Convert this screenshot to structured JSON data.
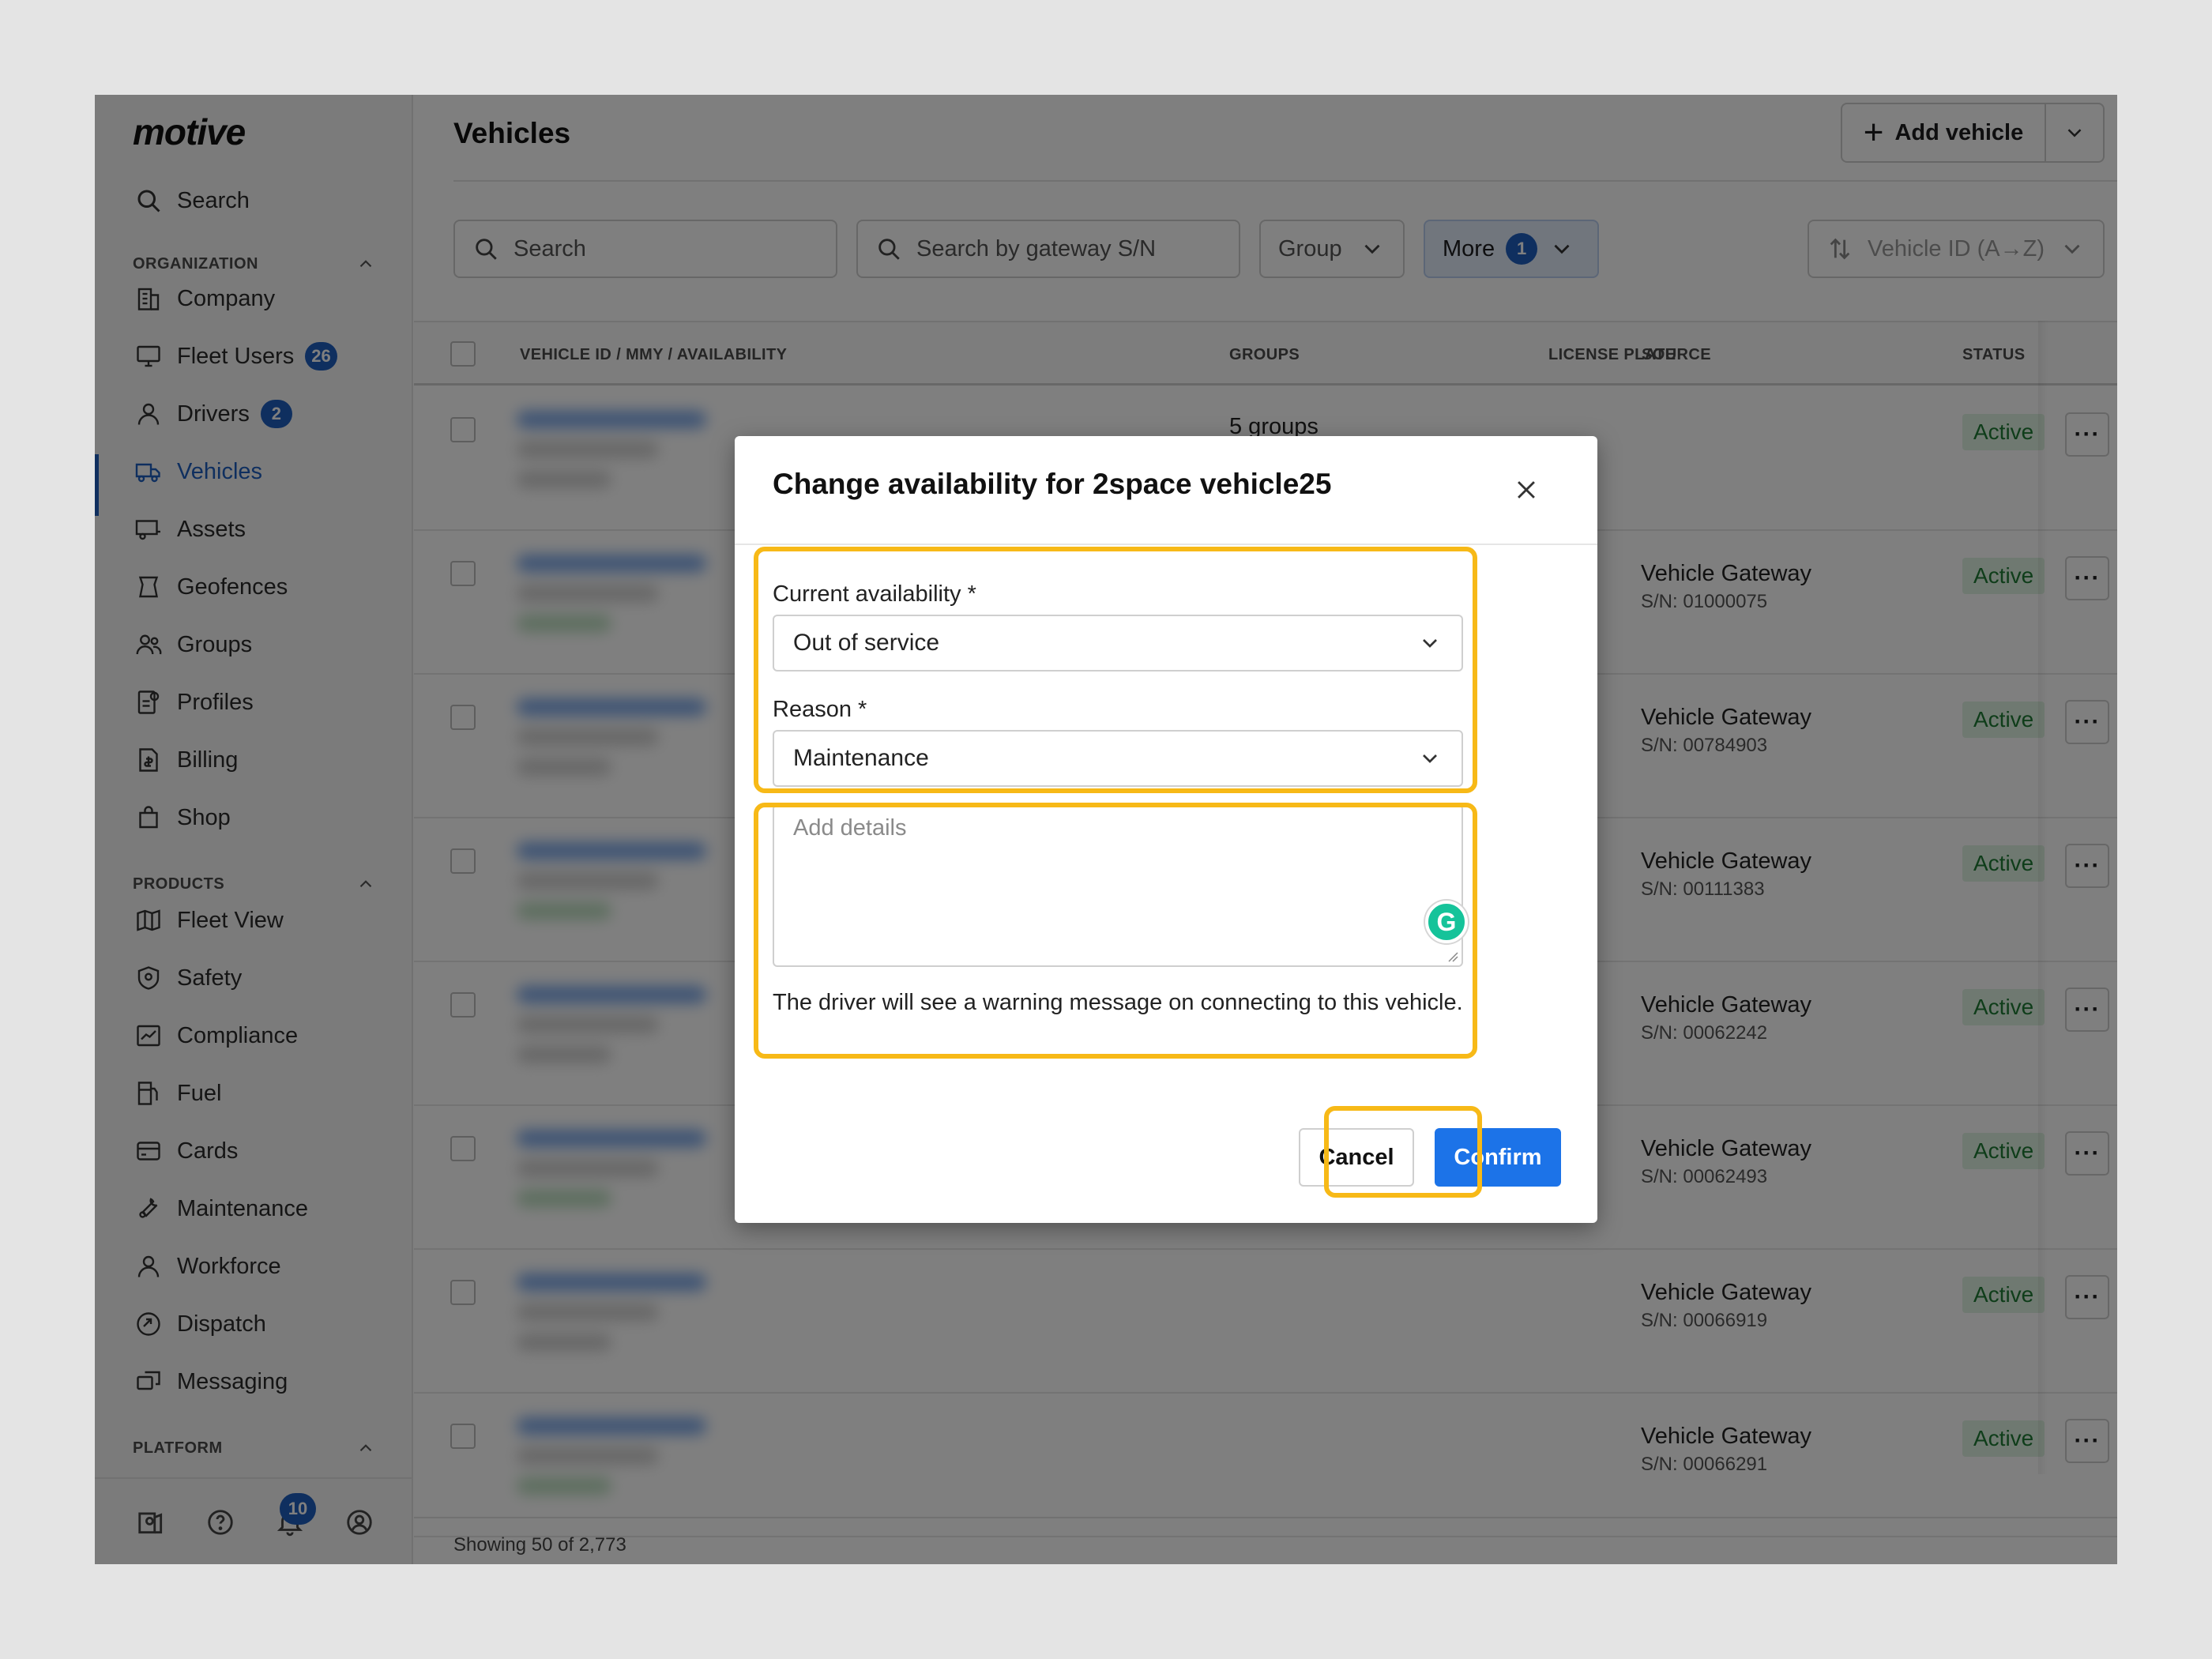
{
  "brand": "motive",
  "sidebar": {
    "search_label": "Search",
    "sections": {
      "organization": "ORGANIZATION",
      "products": "PRODUCTS",
      "platform": "PLATFORM"
    },
    "org_items": [
      {
        "label": "Company",
        "icon": "building-icon"
      },
      {
        "label": "Fleet Users",
        "icon": "monitor-icon",
        "badge": "26"
      },
      {
        "label": "Drivers",
        "icon": "person-icon",
        "badge": "2"
      },
      {
        "label": "Vehicles",
        "icon": "truck-icon",
        "active": true
      },
      {
        "label": "Assets",
        "icon": "trailer-icon"
      },
      {
        "label": "Geofences",
        "icon": "geofence-icon"
      },
      {
        "label": "Groups",
        "icon": "people-icon"
      },
      {
        "label": "Profiles",
        "icon": "profile-gear-icon"
      },
      {
        "label": "Billing",
        "icon": "billing-icon"
      },
      {
        "label": "Shop",
        "icon": "shopping-bag-icon"
      }
    ],
    "product_items": [
      {
        "label": "Fleet View",
        "icon": "map-icon"
      },
      {
        "label": "Safety",
        "icon": "shield-icon"
      },
      {
        "label": "Compliance",
        "icon": "compliance-icon"
      },
      {
        "label": "Fuel",
        "icon": "fuel-icon"
      },
      {
        "label": "Cards",
        "icon": "card-icon"
      },
      {
        "label": "Maintenance",
        "icon": "wrench-icon"
      },
      {
        "label": "Workforce",
        "icon": "person-icon"
      },
      {
        "label": "Dispatch",
        "icon": "dispatch-icon"
      },
      {
        "label": "Messaging",
        "icon": "messaging-icon"
      }
    ],
    "notification_count": "10"
  },
  "header": {
    "title": "Vehicles",
    "add_button": "Add vehicle"
  },
  "filters": {
    "search_placeholder": "Search",
    "gateway_placeholder": "Search by gateway S/N",
    "group_label": "Group",
    "more_label": "More",
    "more_count": "1",
    "sort_label": "Vehicle ID (A→Z)"
  },
  "table": {
    "columns": [
      "VEHICLE ID / MMY / AVAILABILITY",
      "GROUPS",
      "LICENSE PLATE",
      "SOURCE",
      "STATUS"
    ],
    "rows": [
      {
        "groups": "5 groups",
        "source": "",
        "sn": "",
        "status": "Active"
      },
      {
        "groups": "",
        "source": "Vehicle Gateway",
        "sn": "S/N: 01000075",
        "status": "Active"
      },
      {
        "groups": "",
        "source": "Vehicle Gateway",
        "sn": "S/N: 00784903",
        "status": "Active"
      },
      {
        "groups": "",
        "source": "Vehicle Gateway",
        "sn": "S/N: 00111383",
        "status": "Active"
      },
      {
        "groups": "",
        "source": "Vehicle Gateway",
        "sn": "S/N: 00062242",
        "status": "Active"
      },
      {
        "groups": "",
        "source": "Vehicle Gateway",
        "sn": "S/N: 00062493",
        "status": "Active"
      },
      {
        "groups": "",
        "source": "Vehicle Gateway",
        "sn": "S/N: 00066919",
        "status": "Active"
      },
      {
        "groups": "",
        "source": "Vehicle Gateway",
        "sn": "S/N: 00066291",
        "status": "Active"
      }
    ],
    "footer": "Showing 50 of 2,773"
  },
  "modal": {
    "title": "Change availability for 2space vehicle25",
    "availability_label": "Current availability *",
    "availability_value": "Out of service",
    "reason_label": "Reason *",
    "reason_value": "Maintenance",
    "details_placeholder": "Add details",
    "warning": "The driver will see a warning message on connecting to this vehicle.",
    "cancel": "Cancel",
    "confirm": "Confirm"
  },
  "colors": {
    "accent": "#1f5fbf",
    "confirm": "#1c73e8",
    "highlight": "#f7b917",
    "status_bg": "#dff3e2",
    "status_text": "#1e7a34"
  }
}
